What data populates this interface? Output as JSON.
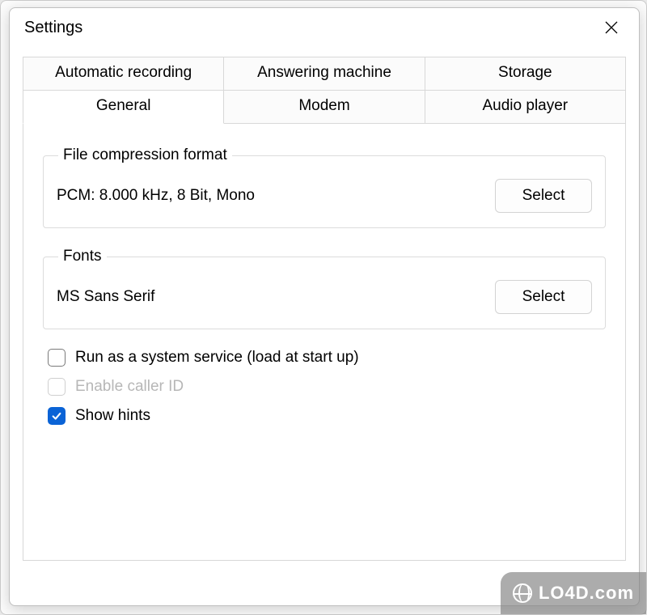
{
  "window": {
    "title": "Settings",
    "close_icon": "close"
  },
  "tabs": {
    "row1": [
      "Automatic recording",
      "Answering machine",
      "Storage"
    ],
    "row2": [
      "General",
      "Modem",
      "Audio player"
    ],
    "active": "General"
  },
  "general": {
    "compression_group_label": "File  compression format",
    "compression_value": "PCM: 8.000 kHz, 8 Bit, Mono",
    "compression_select_label": "Select",
    "fonts_group_label": "Fonts",
    "fonts_value": "MS Sans Serif",
    "fonts_select_label": "Select",
    "checkboxes": {
      "run_service": {
        "label": "Run as a system service (load at start up)",
        "checked": false,
        "enabled": true
      },
      "enable_caller_id": {
        "label": "Enable caller ID",
        "checked": false,
        "enabled": false
      },
      "show_hints": {
        "label": "Show hints",
        "checked": true,
        "enabled": true
      }
    }
  },
  "watermark": "LO4D.com",
  "colors": {
    "accent": "#0a63d6",
    "border": "#d8d8d8"
  }
}
